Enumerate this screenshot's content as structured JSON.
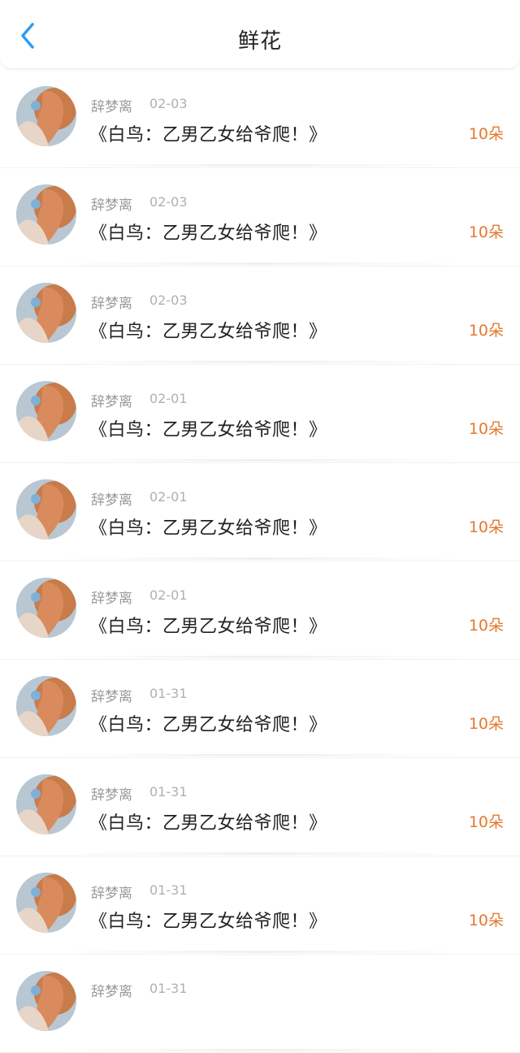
{
  "header": {
    "title": "鲜花",
    "back_icon": "chevron-left-icon",
    "accent": "#2f9cf5"
  },
  "colors": {
    "amount": "#e6782d"
  },
  "items": [
    {
      "name": "辞梦离",
      "date": "02-03",
      "work": "《白鸟：乙男乙女给爷爬！》",
      "amount": "10朵"
    },
    {
      "name": "辞梦离",
      "date": "02-03",
      "work": "《白鸟：乙男乙女给爷爬！》",
      "amount": "10朵"
    },
    {
      "name": "辞梦离",
      "date": "02-03",
      "work": "《白鸟：乙男乙女给爷爬！》",
      "amount": "10朵"
    },
    {
      "name": "辞梦离",
      "date": "02-01",
      "work": "《白鸟：乙男乙女给爷爬！》",
      "amount": "10朵"
    },
    {
      "name": "辞梦离",
      "date": "02-01",
      "work": "《白鸟：乙男乙女给爷爬！》",
      "amount": "10朵"
    },
    {
      "name": "辞梦离",
      "date": "02-01",
      "work": "《白鸟：乙男乙女给爷爬！》",
      "amount": "10朵"
    },
    {
      "name": "辞梦离",
      "date": "01-31",
      "work": "《白鸟：乙男乙女给爷爬！》",
      "amount": "10朵"
    },
    {
      "name": "辞梦离",
      "date": "01-31",
      "work": "《白鸟：乙男乙女给爷爬！》",
      "amount": "10朵"
    },
    {
      "name": "辞梦离",
      "date": "01-31",
      "work": "《白鸟：乙男乙女给爷爬！》",
      "amount": "10朵"
    },
    {
      "name": "辞梦离",
      "date": "01-31",
      "work": "",
      "amount": ""
    }
  ]
}
